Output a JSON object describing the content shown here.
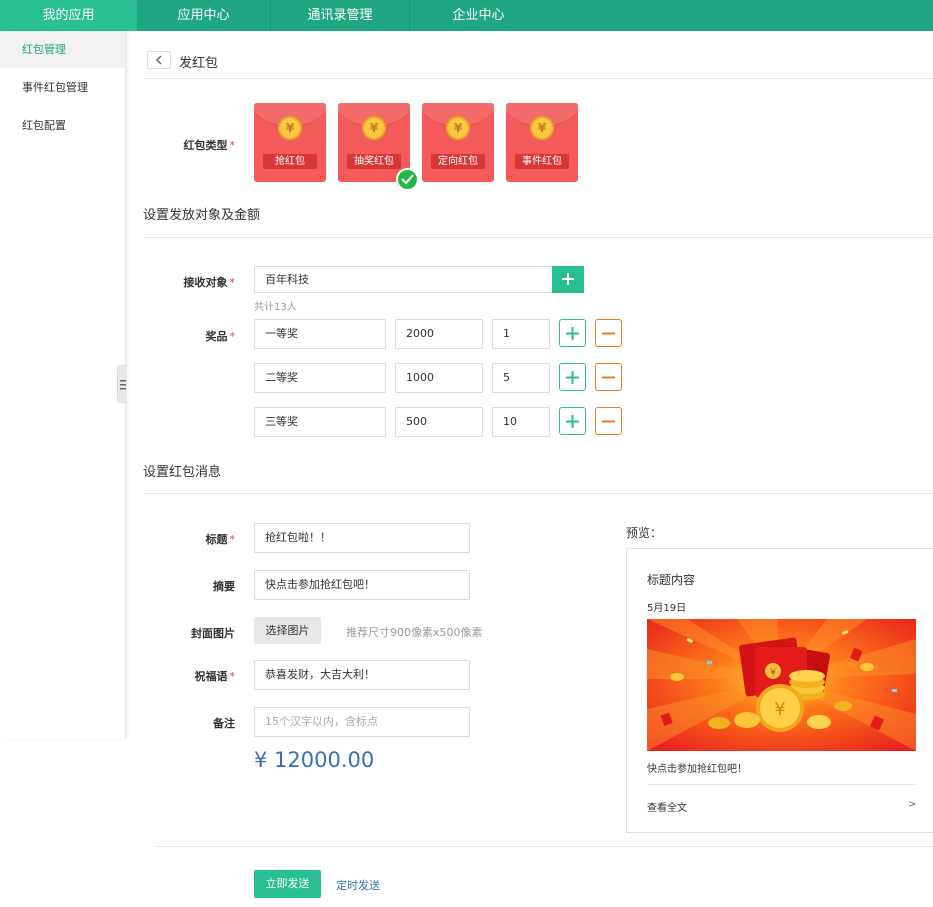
{
  "topnav": {
    "tabs": [
      {
        "label": "我的应用"
      },
      {
        "label": "应用中心"
      },
      {
        "label": "通讯录管理"
      },
      {
        "label": "企业中心"
      }
    ]
  },
  "sidebar": {
    "items": [
      {
        "label": "红包管理",
        "active": true
      },
      {
        "label": "事件红包管理"
      },
      {
        "label": "红包配置"
      }
    ]
  },
  "page": {
    "title": "发红包"
  },
  "packet_type": {
    "label": "红包类型",
    "options": [
      {
        "label": "抢红包"
      },
      {
        "label": "抽奖红包",
        "selected": true
      },
      {
        "label": "定向红包"
      },
      {
        "label": "事件红包"
      }
    ],
    "coin_symbol": "¥"
  },
  "section_target": {
    "title": "设置发放对象及金额",
    "receiver_label": "接收对象",
    "receiver_value": "百年科技",
    "receiver_count": "共计13人",
    "prize_label": "奖品",
    "prizes": [
      {
        "name": "一等奖",
        "amount": "2000",
        "count": "1"
      },
      {
        "name": "二等奖",
        "amount": "1000",
        "count": "5"
      },
      {
        "name": "三等奖",
        "amount": "500",
        "count": "10"
      }
    ]
  },
  "section_message": {
    "title": "设置红包消息",
    "title_label": "标题",
    "title_value": "抢红包啦！！",
    "summary_label": "摘要",
    "summary_value": "快点击参加抢红包吧！",
    "cover_label": "封面图片",
    "cover_button": "选择图片",
    "cover_hint": "推荐尺寸900像素x500像素",
    "blessing_label": "祝福语",
    "blessing_value": "恭喜发财，大吉大利！",
    "remark_label": "备注",
    "remark_placeholder": "15个汉字以内，含标点",
    "total": "¥ 12000.00"
  },
  "preview": {
    "label": "预览：",
    "title": "标题内容",
    "date": "5月19日",
    "desc": "快点击参加抢红包吧！",
    "more": "查看全文",
    "arrow": ">"
  },
  "actions": {
    "send": "立即发送",
    "schedule": "定时发送"
  },
  "colors": {
    "brand": "#1ea781",
    "accent": "#2abf93",
    "minus": "#f07a22",
    "packet": "#f45a5a",
    "total": "#3a6fb3"
  }
}
